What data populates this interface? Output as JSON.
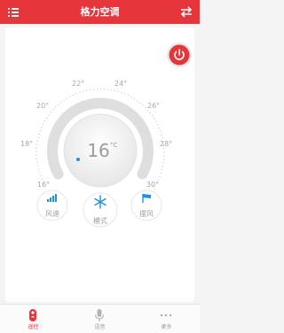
{
  "header": {
    "title": "格力空调",
    "menu_icon": "list-menu-icon",
    "sync_icon": "swap-arrows-icon"
  },
  "power": {
    "icon": "power-icon"
  },
  "dial": {
    "current_temp": "16",
    "unit": "°C",
    "temp_labels": [
      "16°",
      "18°",
      "20°",
      "22°",
      "24°",
      "26°",
      "28°",
      "30°"
    ]
  },
  "modes": [
    {
      "label": "风速",
      "icon": "signal-bars-icon"
    },
    {
      "label": "模式",
      "icon": "snowflake-icon"
    },
    {
      "label": "摆风",
      "icon": "flag-icon"
    }
  ],
  "nav": [
    {
      "label": "遥控",
      "icon": "remote-icon",
      "active": true
    },
    {
      "label": "语音",
      "icon": "microphone-icon",
      "active": false
    },
    {
      "label": "更多",
      "icon": "more-dots-icon",
      "active": false
    }
  ],
  "colors": {
    "brand": "#e7353c",
    "accent": "#1e90e8",
    "background": "#f4f4f4"
  }
}
